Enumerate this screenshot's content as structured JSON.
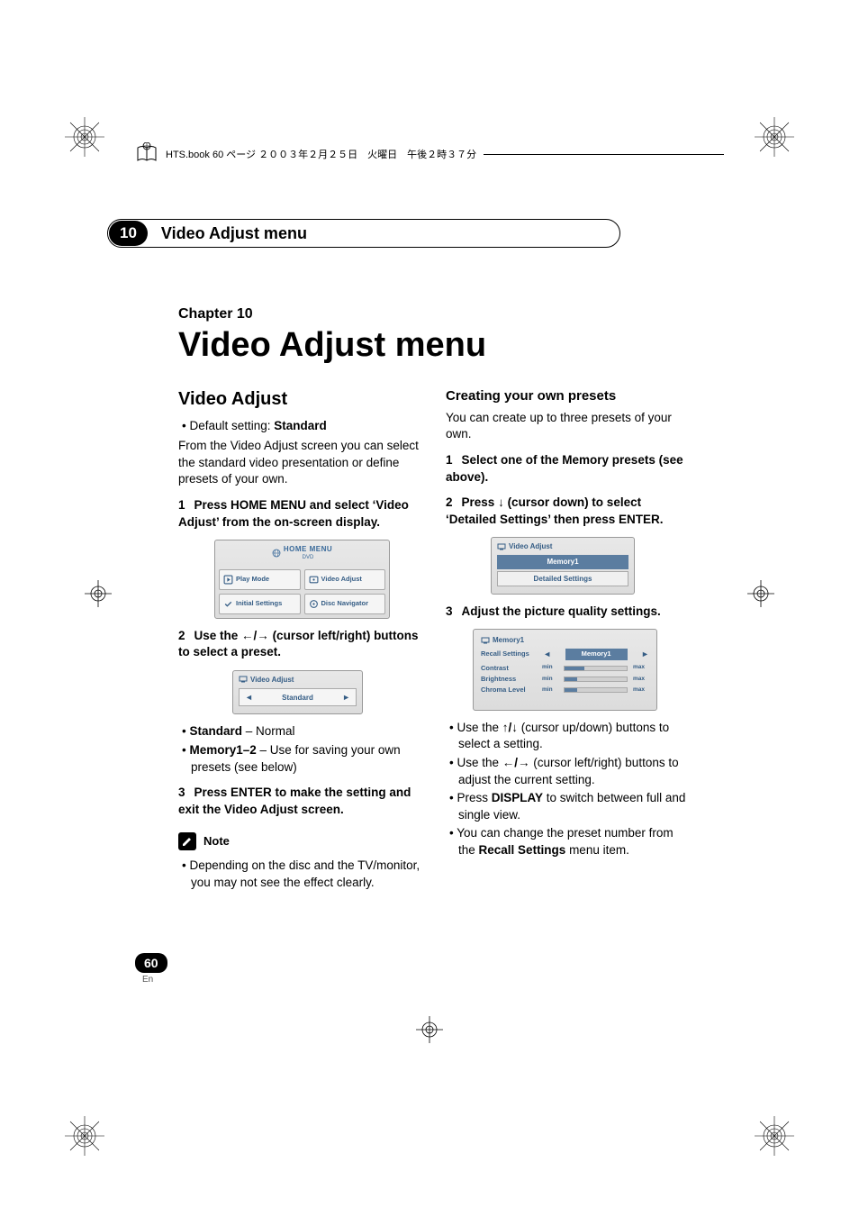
{
  "print_header": {
    "text": "HTS.book  60 ページ  ２００３年２月２５日　火曜日　午後２時３７分"
  },
  "chapter_bar": {
    "number": "10",
    "title": "Video Adjust menu"
  },
  "chapter": {
    "label": "Chapter 10",
    "title": "Video Adjust menu"
  },
  "left": {
    "heading": "Video Adjust",
    "default_label": "Default setting: ",
    "default_value": "Standard",
    "intro": "From the Video Adjust screen you can select the standard video presentation or define presets of your own.",
    "step1": {
      "n": "1",
      "t": "Press HOME MENU and select ‘Video Adjust’ from the on-screen display."
    },
    "home_menu": {
      "title": "HOME MENU",
      "sub": "DVD",
      "cells": [
        "Play Mode",
        "Video Adjust",
        "Initial Settings",
        "Disc Navigator"
      ]
    },
    "step2": {
      "n": "2",
      "t_pre": "Use the ",
      "t_arrows": "←/→",
      "t_post": " (cursor left/right) buttons to select a preset."
    },
    "va_box": {
      "title": "Video Adjust",
      "value": "Standard"
    },
    "bullets": [
      {
        "b": "Standard",
        "rest": "  – Normal"
      },
      {
        "b": "Memory1–2",
        "rest": " – Use for saving your own presets (see below)"
      }
    ],
    "step3": {
      "n": "3",
      "t": "Press ENTER to make the setting and exit the Video Adjust screen."
    },
    "note_label": "Note",
    "note_text": "Depending on the disc and the TV/monitor, you may not see the effect clearly."
  },
  "right": {
    "heading": "Creating your own presets",
    "intro": "You can create up to three presets of your own.",
    "step1": {
      "n": "1",
      "t": "Select one of the Memory presets (see above)."
    },
    "step2": {
      "n": "2",
      "t_pre": "Press ",
      "t_arrow": "↓",
      "t_post": " (cursor down) to select ‘Detailed Settings’ then press ENTER."
    },
    "va_box2": {
      "title": "Video Adjust",
      "sel": "Memory1",
      "btn": "Detailed Settings"
    },
    "step3": {
      "n": "3",
      "t": "Adjust the picture quality settings."
    },
    "mem_box": {
      "title": "Memory1",
      "recall_label": "Recall Settings",
      "recall_value": "Memory1",
      "rows": [
        {
          "label": "Contrast",
          "fill": 32
        },
        {
          "label": "Brightness",
          "fill": 20
        },
        {
          "label": "Chroma Level",
          "fill": 20
        }
      ],
      "min": "min",
      "max": "max"
    },
    "bullets": [
      {
        "pre": "Use the ",
        "arr": "↑/↓",
        "post": " (cursor up/down) buttons to select a setting."
      },
      {
        "pre": "Use the ",
        "arr": "←/→",
        "post": " (cursor left/right) buttons to adjust the current setting."
      },
      {
        "pre": "Press ",
        "b": "DISPLAY",
        "post": " to switch between full and single view."
      },
      {
        "pre": "You can change the preset number from the ",
        "b": "Recall Settings",
        "post": " menu item."
      }
    ]
  },
  "page": {
    "num": "60",
    "lang": "En"
  }
}
